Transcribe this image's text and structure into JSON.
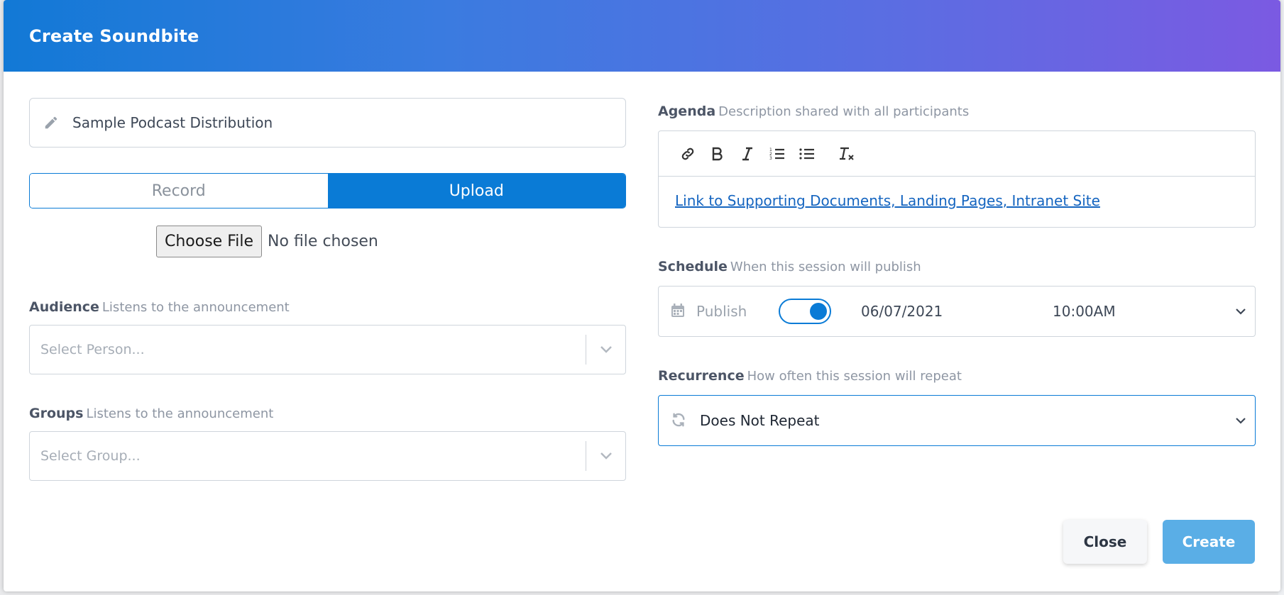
{
  "modal": {
    "title": "Create Soundbite"
  },
  "title_field": {
    "value": "Sample Podcast Distribution"
  },
  "mode_toggle": {
    "record_label": "Record",
    "upload_label": "Upload",
    "selected": "Upload"
  },
  "file_input": {
    "button_label": "Choose File",
    "status": "No file chosen"
  },
  "audience": {
    "label": "Audience",
    "hint": "Listens to the announcement",
    "placeholder": "Select Person..."
  },
  "groups": {
    "label": "Groups",
    "hint": "Listens to the announcement",
    "placeholder": "Select Group..."
  },
  "agenda": {
    "label": "Agenda",
    "hint": "Description shared with all participants",
    "toolbar": [
      "link-icon",
      "bold-icon",
      "italic-icon",
      "ordered-list-icon",
      "bullet-list-icon",
      "clear-format-icon"
    ],
    "content_link": "Link to Supporting Documents, Landing Pages, Intranet Site"
  },
  "schedule": {
    "label": "Schedule",
    "hint": "When this session will publish",
    "publish_label": "Publish",
    "publish_enabled": true,
    "date": "06/07/2021",
    "time": "10:00AM"
  },
  "recurrence": {
    "label": "Recurrence",
    "hint": "How often this session will repeat",
    "value": "Does Not Repeat"
  },
  "footer": {
    "close_label": "Close",
    "create_label": "Create"
  },
  "colors": {
    "accent": "#0a7bd6",
    "header_gradient_start": "#1279d6",
    "header_gradient_end": "#7b5ae2",
    "create_button": "#5aaee6"
  }
}
